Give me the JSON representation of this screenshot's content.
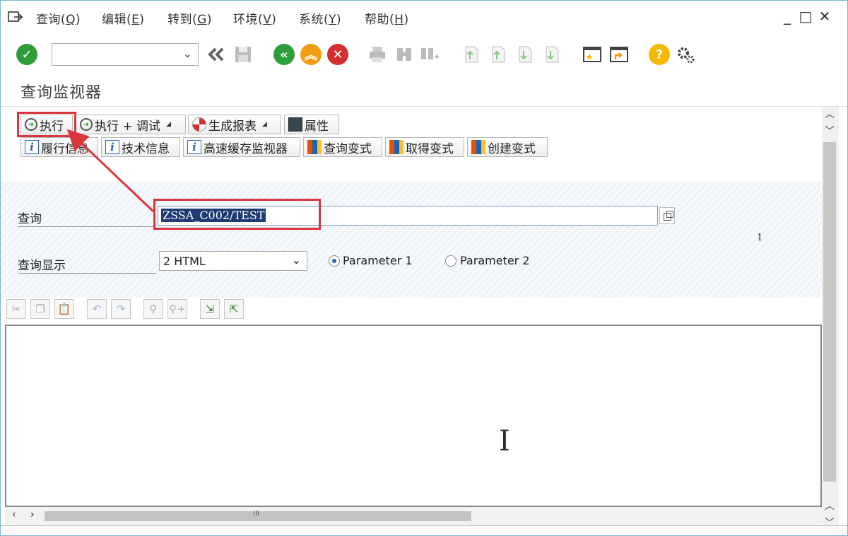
{
  "menubar": {
    "items": [
      {
        "text": "查询(",
        "key": "Q",
        "end": ")"
      },
      {
        "text": "编辑(",
        "key": "E",
        "end": ")"
      },
      {
        "text": "转到(",
        "key": "G",
        "end": ")"
      },
      {
        "text": "环境(",
        "key": "V",
        "end": ")"
      },
      {
        "text": "系统(",
        "key": "Y",
        "end": ")"
      },
      {
        "text": "帮助(",
        "key": "H",
        "end": ")"
      }
    ],
    "window_controls": [
      "_",
      "□",
      "✕"
    ]
  },
  "toolbar": {
    "icons": [
      "check-icon",
      "back-double-icon",
      "save-icon",
      "back-icon",
      "exit-icon",
      "cancel-icon",
      "print-icon",
      "find-icon",
      "find-next-icon",
      "first-page-icon",
      "prev-page-icon",
      "next-page-icon",
      "last-page-icon",
      "new-session-icon",
      "shortcut-icon",
      "help-icon",
      "customize-icon"
    ],
    "colors": {
      "green": "#2e9d3a",
      "orange": "#f39c12",
      "red": "#d32f2f",
      "yellow": "#f6b800"
    }
  },
  "page_title": "查询监视器",
  "app_toolbar": {
    "row1": [
      {
        "label": "执行",
        "icon": "execute-icon"
      },
      {
        "label": "执行 + 调试",
        "icon": "execute-debug-icon",
        "menu": true
      },
      {
        "label": "生成报表",
        "icon": "report-icon",
        "menu": true
      },
      {
        "label": "属性",
        "icon": "properties-icon"
      }
    ],
    "row2": [
      {
        "label": "履行信息",
        "icon": "info-icon"
      },
      {
        "label": "技术信息",
        "icon": "info-icon"
      },
      {
        "label": "高速缓存监视器",
        "icon": "info-icon"
      },
      {
        "label": "查询变式",
        "icon": "variant-icon"
      },
      {
        "label": "取得变式",
        "icon": "variant-icon"
      },
      {
        "label": "创建变式",
        "icon": "variant-icon"
      }
    ]
  },
  "form": {
    "query_label": "查询",
    "query_value": "ZSSA_C002/TEST",
    "display_label": "查询显示",
    "display_value": "2 HTML",
    "side_number": "1",
    "radio1": "Parameter 1",
    "radio2": "Parameter 2",
    "radio_selected": "Parameter 1"
  },
  "scroll_glyph": "III"
}
